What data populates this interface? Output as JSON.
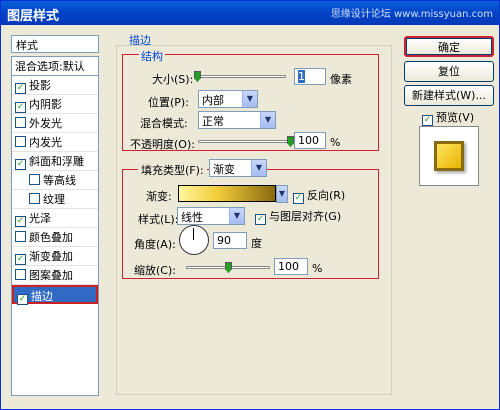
{
  "window": {
    "title": "图层样式",
    "watermark": "思缘设计论坛 www.missyuan.com"
  },
  "sidebar": {
    "header": "样式",
    "items": [
      {
        "label": "混合选项:默认",
        "checkbox": false,
        "checked": false,
        "indent": false
      },
      {
        "label": "投影",
        "checkbox": true,
        "checked": true,
        "indent": false
      },
      {
        "label": "内阴影",
        "checkbox": true,
        "checked": true,
        "indent": false
      },
      {
        "label": "外发光",
        "checkbox": true,
        "checked": false,
        "indent": false
      },
      {
        "label": "内发光",
        "checkbox": true,
        "checked": false,
        "indent": false
      },
      {
        "label": "斜面和浮雕",
        "checkbox": true,
        "checked": true,
        "indent": false
      },
      {
        "label": "等高线",
        "checkbox": true,
        "checked": false,
        "indent": true
      },
      {
        "label": "纹理",
        "checkbox": true,
        "checked": false,
        "indent": true
      },
      {
        "label": "光泽",
        "checkbox": true,
        "checked": true,
        "indent": false
      },
      {
        "label": "颜色叠加",
        "checkbox": true,
        "checked": false,
        "indent": false
      },
      {
        "label": "渐变叠加",
        "checkbox": true,
        "checked": true,
        "indent": false
      },
      {
        "label": "图案叠加",
        "checkbox": true,
        "checked": false,
        "indent": false
      },
      {
        "label": "描边",
        "checkbox": true,
        "checked": true,
        "indent": false,
        "selected": true
      }
    ]
  },
  "stroke": {
    "section_title": "描边",
    "structure_title": "结构",
    "size_label": "大小(S):",
    "size_value": "1",
    "size_unit": "像素",
    "size_slider_fraction": 0.01,
    "position_label": "位置(P):",
    "position_value": "内部",
    "blend_label": "混合模式:",
    "blend_value": "正常",
    "opacity_label": "不透明度(O):",
    "opacity_value": "100",
    "opacity_unit": "%",
    "opacity_slider_fraction": 1.0
  },
  "fill": {
    "type_label": "填充类型(F):",
    "type_value": "渐变",
    "gradient_label": "渐变:",
    "reverse_label": "反向(R)",
    "reverse_checked": true,
    "style_label": "样式(L):",
    "style_value": "线性",
    "align_label": "与图层对齐(G)",
    "align_checked": true,
    "angle_label": "角度(A):",
    "angle_value": "90",
    "angle_unit": "度",
    "scale_label": "缩放(C):",
    "scale_value": "100",
    "scale_unit": "%",
    "scale_slider_fraction": 0.5
  },
  "buttons": {
    "ok": "确定",
    "reset": "复位",
    "new_style": "新建样式(W)...",
    "preview_label": "预览(V)",
    "preview_checked": true
  },
  "colors": {
    "accent": "#316ac5",
    "highlight_border": "#cc2233",
    "group_title": "#0046d5"
  }
}
